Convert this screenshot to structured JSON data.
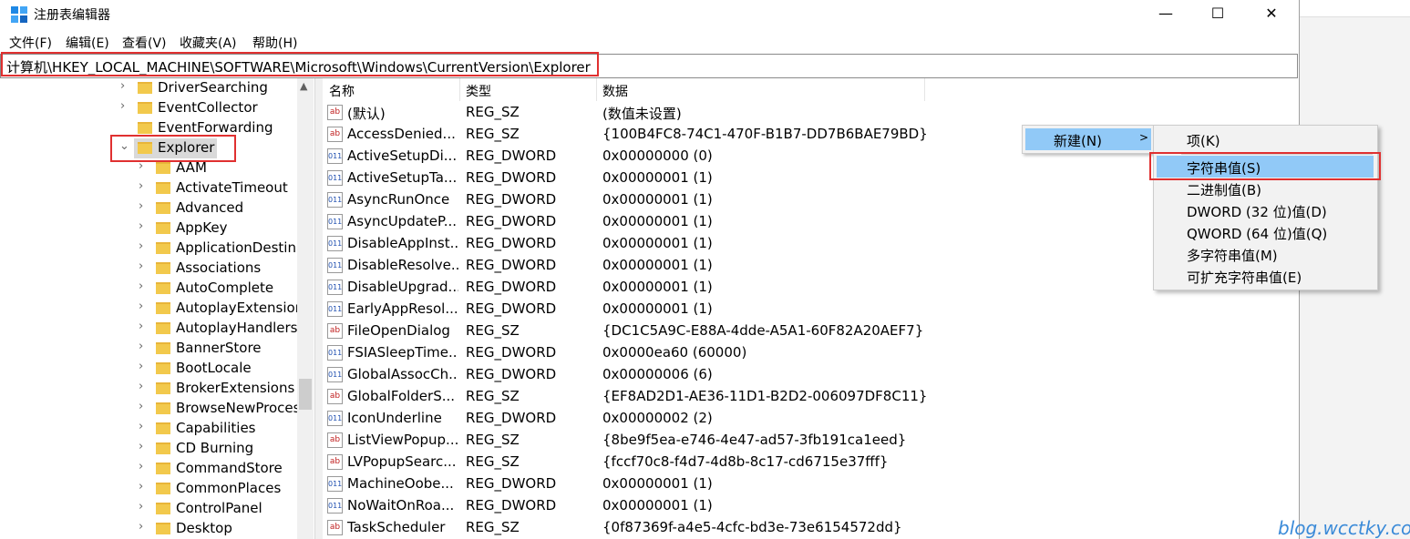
{
  "window": {
    "title": "注册表编辑器",
    "minimize_label": "—",
    "maximize_label": "☐",
    "close_label": "✕"
  },
  "menubar": {
    "items": [
      "文件(F)",
      "编辑(E)",
      "查看(V)",
      "收藏夹(A)",
      "帮助(H)"
    ]
  },
  "address": {
    "path": "计算机\\HKEY_LOCAL_MACHINE\\SOFTWARE\\Microsoft\\Windows\\CurrentVersion\\Explorer"
  },
  "tree": {
    "parents": [
      {
        "label": "DriverSearching",
        "expanded": false
      },
      {
        "label": "EventCollector",
        "expanded": false
      },
      {
        "label": "EventForwarding",
        "expanded": false
      },
      {
        "label": "Explorer",
        "expanded": true,
        "selected": true
      }
    ],
    "children": [
      "AAM",
      "ActivateTimeout",
      "Advanced",
      "AppKey",
      "ApplicationDestina",
      "Associations",
      "AutoComplete",
      "AutoplayExtension",
      "AutoplayHandlers",
      "BannerStore",
      "BootLocale",
      "BrokerExtensions",
      "BrowseNewProces",
      "Capabilities",
      "CD Burning",
      "CommandStore",
      "CommonPlaces",
      "ControlPanel",
      "Desktop"
    ]
  },
  "list": {
    "columns": [
      "名称",
      "类型",
      "数据"
    ],
    "rows": [
      {
        "name": "(默认)",
        "type": "REG_SZ",
        "data": "(数值未设置)",
        "icon": "ab"
      },
      {
        "name": "AccessDenied...",
        "type": "REG_SZ",
        "data": "{100B4FC8-74C1-470F-B1B7-DD7B6BAE79BD}",
        "icon": "ab"
      },
      {
        "name": "ActiveSetupDi...",
        "type": "REG_DWORD",
        "data": "0x00000000 (0)",
        "icon": "bin"
      },
      {
        "name": "ActiveSetupTa...",
        "type": "REG_DWORD",
        "data": "0x00000001 (1)",
        "icon": "bin"
      },
      {
        "name": "AsyncRunOnce",
        "type": "REG_DWORD",
        "data": "0x00000001 (1)",
        "icon": "bin"
      },
      {
        "name": "AsyncUpdateP...",
        "type": "REG_DWORD",
        "data": "0x00000001 (1)",
        "icon": "bin"
      },
      {
        "name": "DisableAppInst...",
        "type": "REG_DWORD",
        "data": "0x00000001 (1)",
        "icon": "bin"
      },
      {
        "name": "DisableResolve...",
        "type": "REG_DWORD",
        "data": "0x00000001 (1)",
        "icon": "bin"
      },
      {
        "name": "DisableUpgrad...",
        "type": "REG_DWORD",
        "data": "0x00000001 (1)",
        "icon": "bin"
      },
      {
        "name": "EarlyAppResol...",
        "type": "REG_DWORD",
        "data": "0x00000001 (1)",
        "icon": "bin"
      },
      {
        "name": "FileOpenDialog",
        "type": "REG_SZ",
        "data": "{DC1C5A9C-E88A-4dde-A5A1-60F82A20AEF7}",
        "icon": "ab"
      },
      {
        "name": "FSIASleepTime...",
        "type": "REG_DWORD",
        "data": "0x0000ea60 (60000)",
        "icon": "bin"
      },
      {
        "name": "GlobalAssocCh...",
        "type": "REG_DWORD",
        "data": "0x00000006 (6)",
        "icon": "bin"
      },
      {
        "name": "GlobalFolderS...",
        "type": "REG_SZ",
        "data": "{EF8AD2D1-AE36-11D1-B2D2-006097DF8C11}",
        "icon": "ab"
      },
      {
        "name": "IconUnderline",
        "type": "REG_DWORD",
        "data": "0x00000002 (2)",
        "icon": "bin"
      },
      {
        "name": "ListViewPopup...",
        "type": "REG_SZ",
        "data": "{8be9f5ea-e746-4e47-ad57-3fb191ca1eed}",
        "icon": "ab"
      },
      {
        "name": "LVPopupSearc...",
        "type": "REG_SZ",
        "data": "{fccf70c8-f4d7-4d8b-8c17-cd6715e37fff}",
        "icon": "ab"
      },
      {
        "name": "MachineOobe...",
        "type": "REG_DWORD",
        "data": "0x00000001 (1)",
        "icon": "bin"
      },
      {
        "name": "NoWaitOnRoa...",
        "type": "REG_DWORD",
        "data": "0x00000001 (1)",
        "icon": "bin"
      },
      {
        "name": "TaskScheduler",
        "type": "REG_SZ",
        "data": "{0f87369f-a4e5-4cfc-bd3e-73e6154572dd}",
        "icon": "ab"
      }
    ]
  },
  "context_menu": {
    "new_label": "新建(N)",
    "arrow": ">",
    "submenu": [
      "项(K)",
      "字符串值(S)",
      "二进制值(B)",
      "DWORD (32 位)值(D)",
      "QWORD (64 位)值(Q)",
      "多字符串值(M)",
      "可扩充字符串值(E)"
    ]
  },
  "watermark": "blog.wcctky.com",
  "colors": {
    "highlight_box": "#e03030",
    "menu_hover": "#91c9f7",
    "folder": "#f2c94c",
    "watermark": "#3a8ad8"
  }
}
